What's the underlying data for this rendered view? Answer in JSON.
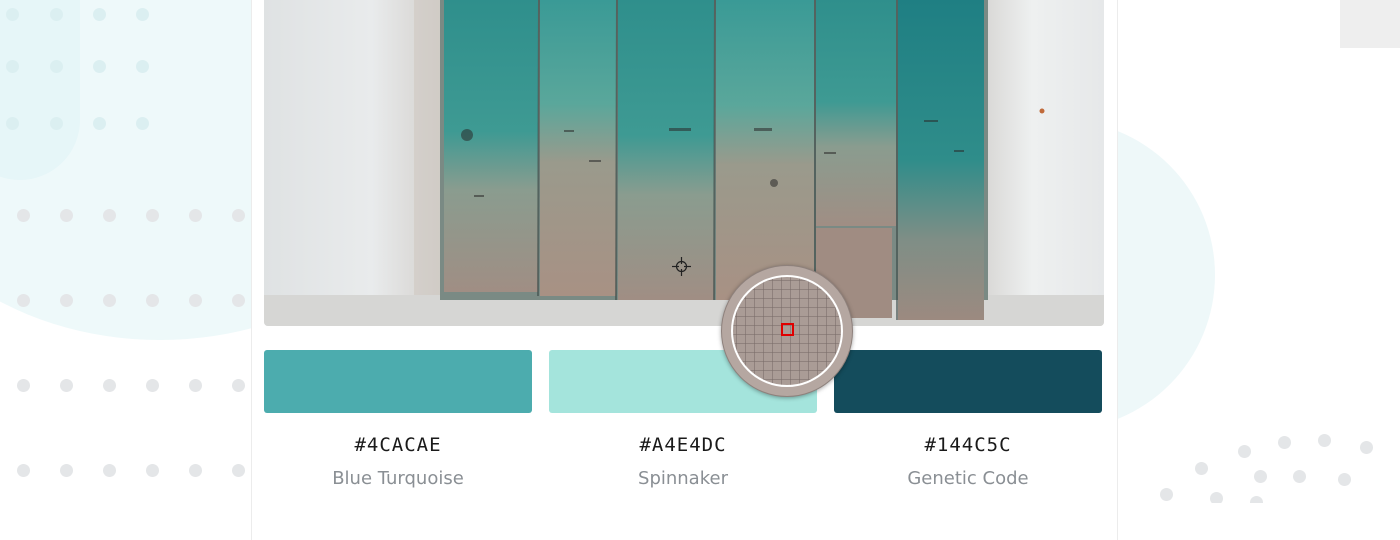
{
  "colors": {
    "accent": "#4CACAE",
    "background": "#ffffff"
  },
  "palette": [
    {
      "hex": "#4CACAE",
      "name": "Blue Turquoise",
      "color": "#4CACAE"
    },
    {
      "hex": "#A4E4DC",
      "name": "Spinnaker",
      "color": "#A4E4DC"
    },
    {
      "hex": "#144C5C",
      "name": "Genetic Code",
      "color": "#144C5C"
    }
  ],
  "tools": {
    "picker_cursor_icon": "crosshair-icon",
    "magnifier_icon": "magnifier-loupe-icon",
    "magnifier_sample_color": "#AA9C96",
    "magnifier_marker_color": "#E00000"
  }
}
